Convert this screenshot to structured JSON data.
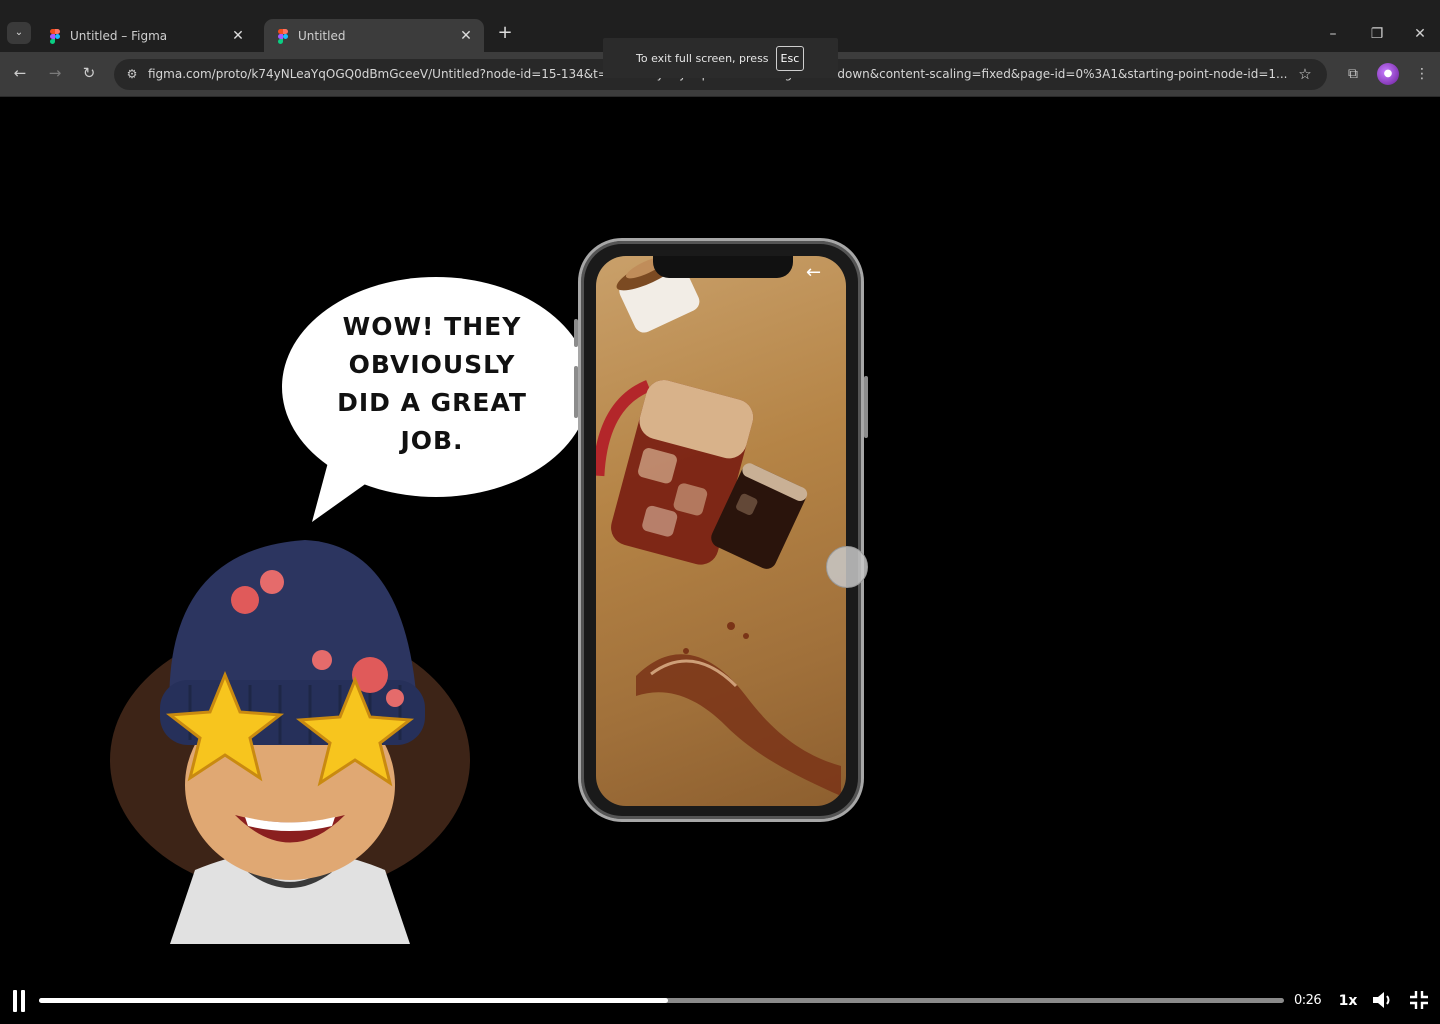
{
  "browser": {
    "tabs": [
      {
        "title": "Untitled – Figma",
        "active": false
      },
      {
        "title": "Untitled",
        "active": true
      }
    ],
    "new_tab_icon": "plus-icon",
    "url": "figma.com/proto/k74yNLeaYqOGQ0dBmGceeV/Untitled?node-id=15-134&t=dXh2COy41yl4qvGe-0&scaling=scale-down&content-scaling=fixed&page-id=0%3A1&starting-point-node-id=1...",
    "fullscreen_toast": {
      "text": "To exit full screen, press",
      "key": "Esc"
    }
  },
  "speech_bubble": {
    "lines": [
      "WOW! THEY",
      "OBVIOUSLY",
      "DID A GREAT",
      "JOB."
    ]
  },
  "video": {
    "progress": 0.505,
    "time": "0:26",
    "speed": "1x"
  },
  "colors": {
    "chrome_dark": "#1f1f1f",
    "chrome_mid": "#3c3c3c",
    "screen_gold": "#b58446",
    "progress_fill": "#ffffff"
  }
}
